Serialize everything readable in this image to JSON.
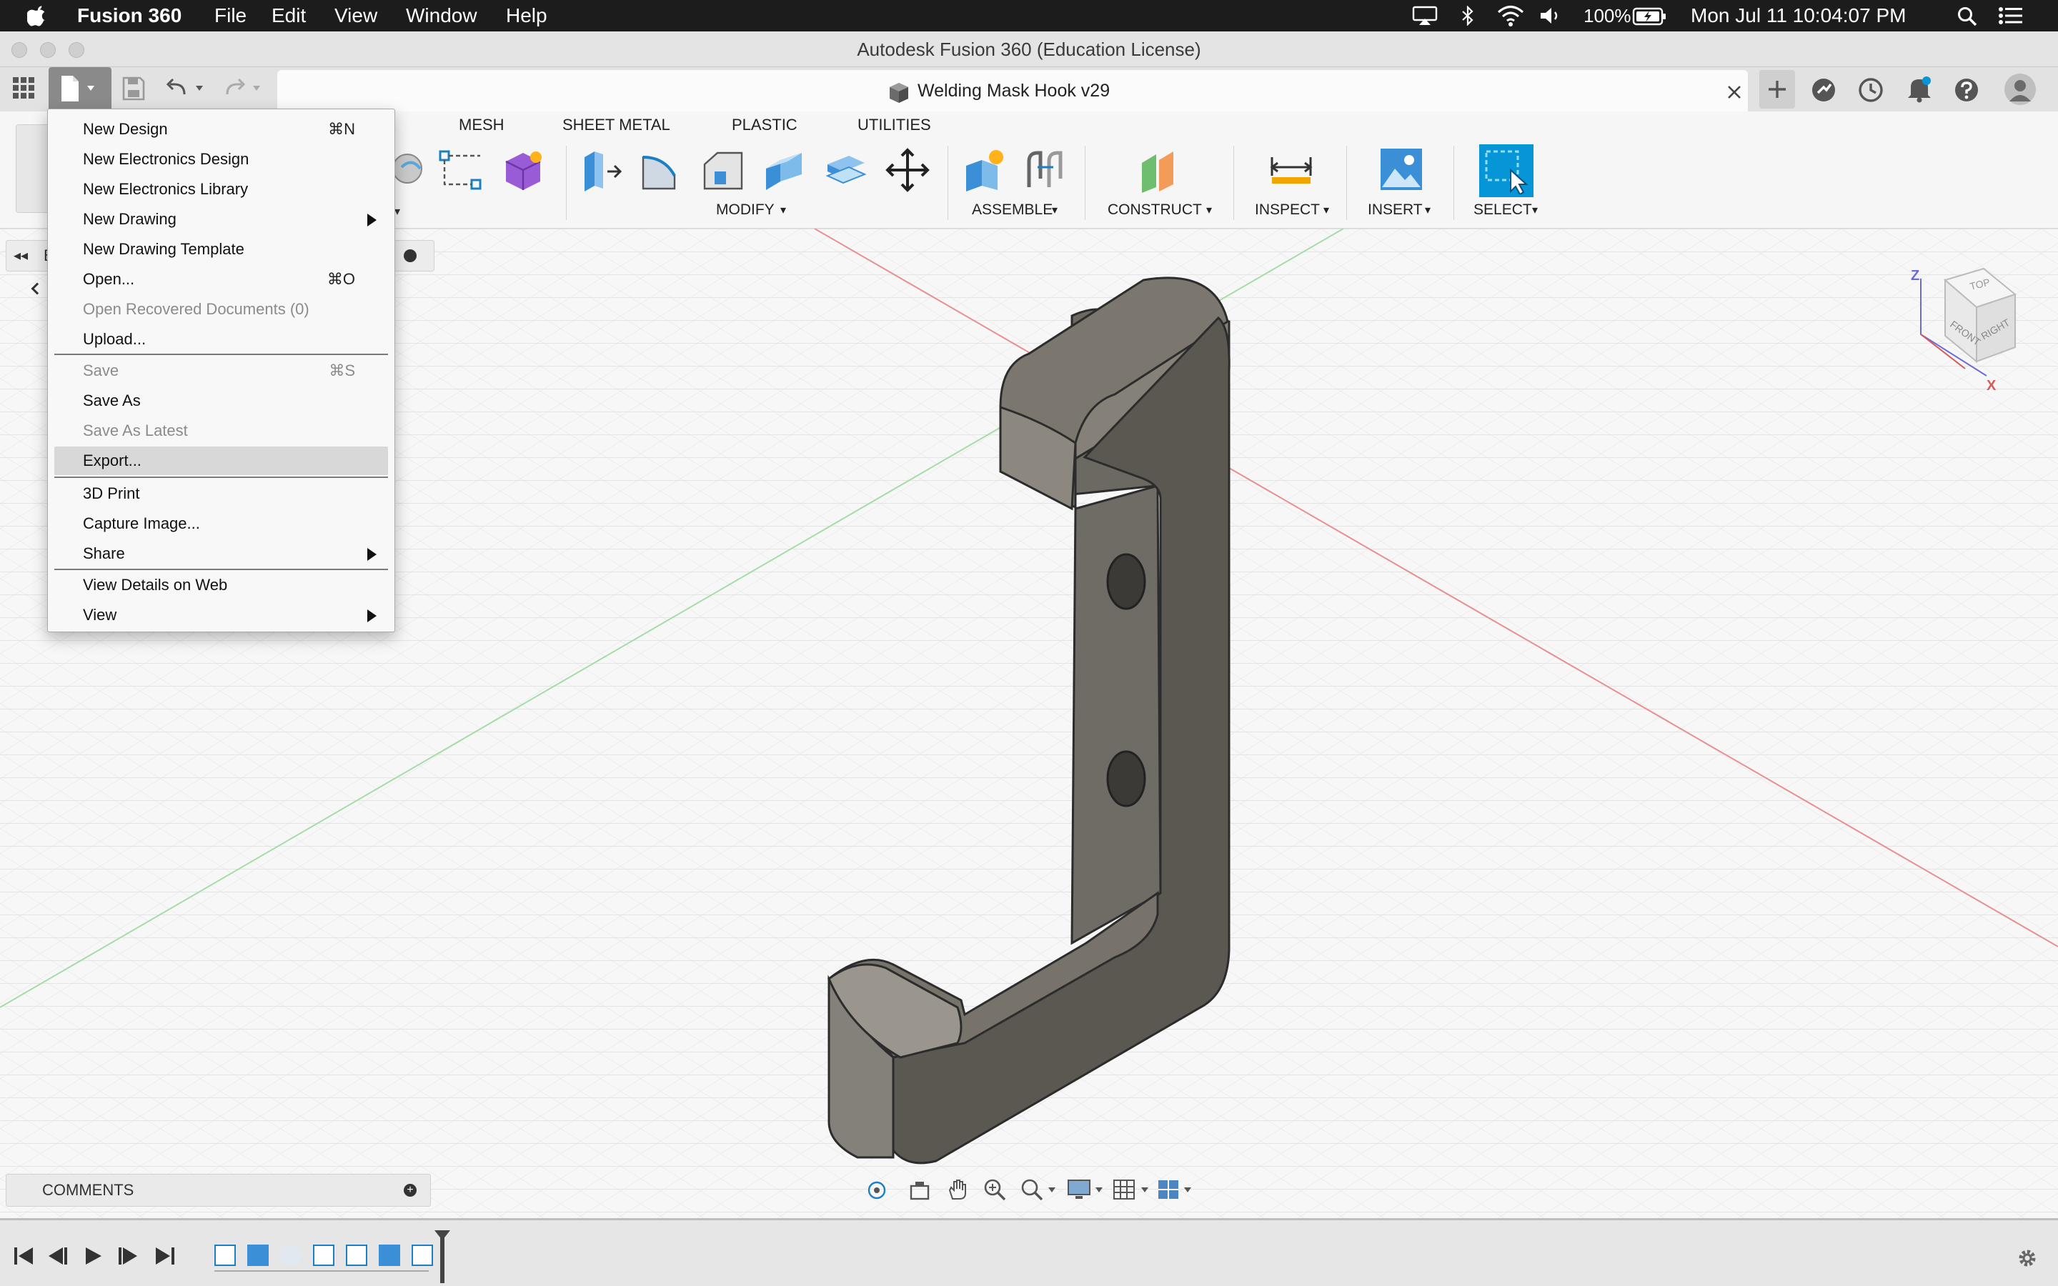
{
  "system_menubar": {
    "app_name": "Fusion 360",
    "menus": [
      "File",
      "Edit",
      "View",
      "Window",
      "Help"
    ],
    "battery": "100%",
    "datetime": "Mon Jul 11  10:04:07 PM"
  },
  "window": {
    "title": "Autodesk Fusion 360 (Education License)"
  },
  "document_tab": {
    "title": "Welding Mask Hook v29"
  },
  "toolbar": {
    "tabs": [
      "MESH",
      "SHEET METAL",
      "PLASTIC",
      "UTILITIES"
    ],
    "groups": [
      "MODIFY",
      "ASSEMBLE",
      "CONSTRUCT",
      "INSPECT",
      "INSERT",
      "SELECT"
    ],
    "panel_collapse_glyph": "◂◂",
    "panel_letter": "B"
  },
  "file_menu": {
    "items": [
      {
        "label": "New Design",
        "shortcut": "⌘N"
      },
      {
        "label": "New Electronics Design"
      },
      {
        "label": "New Electronics Library"
      },
      {
        "label": "New Drawing",
        "submenu": true
      },
      {
        "label": "New Drawing Template"
      },
      {
        "label": "Open...",
        "shortcut": "⌘O"
      },
      {
        "label": "Open Recovered Documents (0)",
        "disabled": true
      },
      {
        "label": "Upload..."
      },
      {
        "label": "Save",
        "shortcut": "⌘S",
        "disabled": true
      },
      {
        "label": "Save As"
      },
      {
        "label": "Save As Latest",
        "disabled": true
      },
      {
        "label": "Export...",
        "highlighted": true
      },
      {
        "label": "3D Print"
      },
      {
        "label": "Capture Image..."
      },
      {
        "label": "Share",
        "submenu": true
      },
      {
        "label": "View Details on Web"
      },
      {
        "label": "View",
        "submenu": true
      }
    ]
  },
  "viewcube": {
    "top": "TOP",
    "front": "FRONT",
    "right": "RIGHT",
    "axis_z": "Z",
    "axis_x": "X"
  },
  "comments": {
    "label": "COMMENTS"
  },
  "colors": {
    "menubar_bg": "#1c1c1c",
    "accent_blue": "#0696d7",
    "model_body": "#5b5852",
    "x_axis": "#e06666",
    "y_axis": "#8ad08a"
  }
}
